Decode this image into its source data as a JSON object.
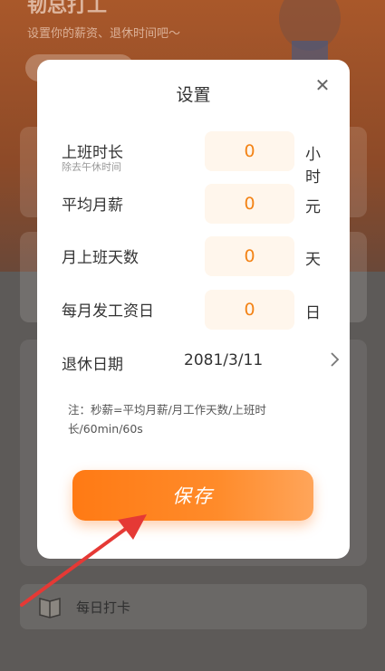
{
  "background": {
    "title": "韧总打工",
    "subtitle": "设置你的薪资、退休时间吧～",
    "daily_checkin_label": "每日打卡"
  },
  "modal": {
    "title": "设置",
    "rows": [
      {
        "label": "上班时长",
        "sublabel": "除去午休时间",
        "value": "0",
        "unit": "小时"
      },
      {
        "label": "平均月薪",
        "value": "0",
        "unit": "元"
      },
      {
        "label": "月上班天数",
        "value": "0",
        "unit": "天"
      },
      {
        "label": "每月发工资日",
        "value": "0",
        "unit": "日"
      }
    ],
    "retire": {
      "label": "退休日期",
      "value": "2081/3/11"
    },
    "note": "注：秒薪=平均月薪/月工作天数/上班时长/60min/60s",
    "save_label": "保存"
  },
  "colors": {
    "accent": "#f38316",
    "input_bg": "#fff6ec",
    "annotation": "#e53935"
  },
  "icons": [
    "close-icon",
    "chevron-right-icon",
    "book-icon",
    "red-arrow-annotation"
  ]
}
